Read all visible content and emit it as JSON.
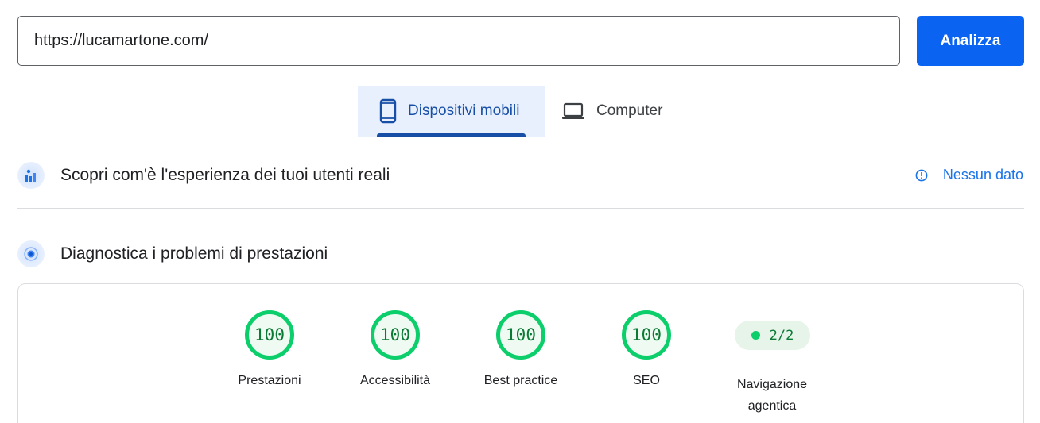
{
  "search": {
    "url_value": "https://lucamartone.com/",
    "analyze_label": "Analizza"
  },
  "tabs": [
    {
      "label": "Dispositivi mobili",
      "icon": "smartphone-icon",
      "selected": true
    },
    {
      "label": "Computer",
      "icon": "laptop-icon",
      "selected": false
    }
  ],
  "real_users": {
    "title": "Scopri com'è l'esperienza dei tuoi utenti reali",
    "status": "Nessun dato",
    "status_icon": "info-icon"
  },
  "diagnostics": {
    "title": "Diagnostica i problemi di prestazioni",
    "scores": [
      {
        "value": "100",
        "label": "Prestazioni"
      },
      {
        "value": "100",
        "label": "Accessibilità"
      },
      {
        "value": "100",
        "label": "Best practice"
      },
      {
        "value": "100",
        "label": "SEO"
      }
    ],
    "agentic": {
      "value": "2/2",
      "label_line1": "Navigazione",
      "label_line2": "agentica"
    }
  },
  "colors": {
    "accent": "#0b63f2",
    "tab_active": "#174ea6",
    "link": "#1a73e8",
    "pass_green": "#0cce6b",
    "pass_text": "#0b7a34"
  }
}
